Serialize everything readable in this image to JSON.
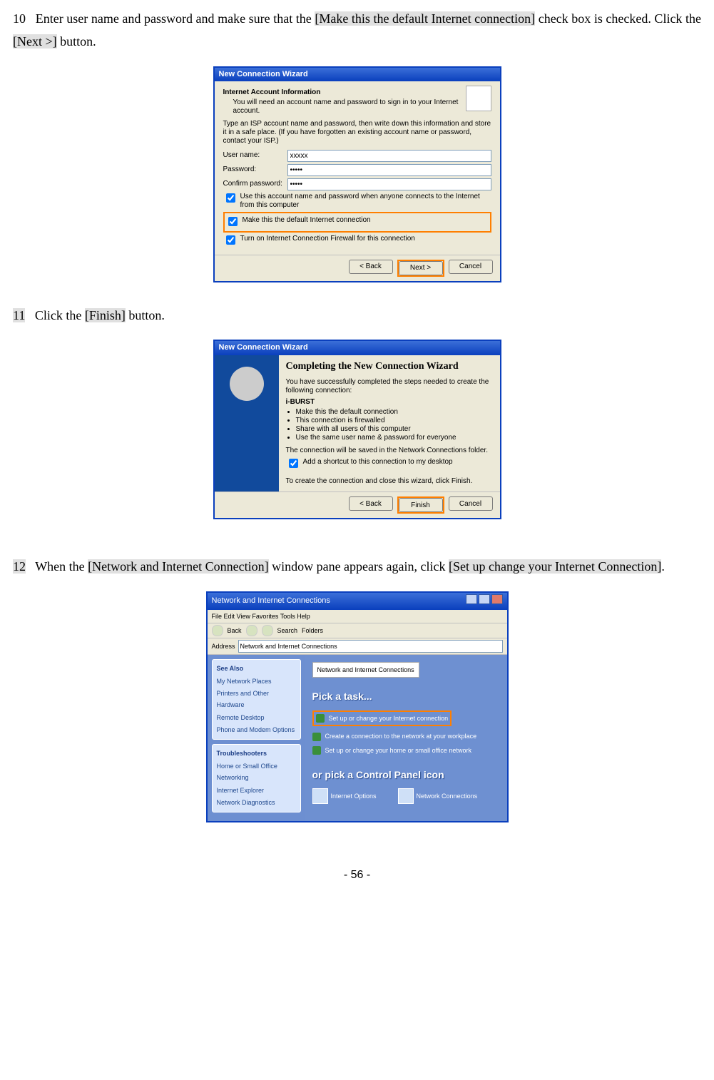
{
  "step10": {
    "num": "10",
    "t1": "Enter user name and password and make sure that the ",
    "h1": "[Make this the default Internet connection]",
    "t2": " check box is checked. Click the ",
    "h2": "[Next >]",
    "t3": " button."
  },
  "win1": {
    "title": "New Connection Wizard",
    "header": "Internet Account Information",
    "sub": "You will need an account name and password to sign in to your Internet account.",
    "note": "Type an ISP account name and password, then write down this information and store it in a safe place. (If you have forgotten an existing account name or password, contact your ISP.)",
    "l_user": "User name:",
    "v_user": "xxxxx",
    "l_pass": "Password:",
    "v_pass": "•••••",
    "l_cpass": "Confirm password:",
    "v_cpass": "•••••",
    "cb1": "Use this account name and password when anyone connects to the Internet from this computer",
    "cb2": "Make this the default Internet connection",
    "cb3": "Turn on Internet Connection Firewall for this connection",
    "back": "< Back",
    "next": "Next >",
    "cancel": "Cancel"
  },
  "step11": {
    "num": "11",
    "t1": "Click the ",
    "h1": "[Finish]",
    "t2": " button."
  },
  "win2": {
    "title": "New Connection Wizard",
    "h": "Completing the New Connection Wizard",
    "p1": "You have successfully completed the steps needed to create the following connection:",
    "name": "i-BURST",
    "b1": "Make this the default connection",
    "b2": "This connection is firewalled",
    "b3": "Share with all users of this computer",
    "b4": "Use the same user name & password for everyone",
    "p2": "The connection will be saved in the Network Connections folder.",
    "cb": "Add a shortcut to this connection to my desktop",
    "p3": "To create the connection and close this wizard, click Finish.",
    "back": "< Back",
    "finish": "Finish",
    "cancel": "Cancel"
  },
  "step12": {
    "num": "12",
    "t1": "When the ",
    "h1": "[Network and Internet Connection]",
    "t2": " window pane appears again, click ",
    "h2": "[Set up change your Internet Connection]",
    "t3": "."
  },
  "cp": {
    "title": "Network and Internet Connections",
    "menu": "File   Edit   View   Favorites   Tools   Help",
    "tool_back": "Back",
    "tool_search": "Search",
    "tool_folders": "Folders",
    "addr_label": "Address",
    "addr_value": "Network and Internet Connections",
    "sa_title": "See Also",
    "sa1": "My Network Places",
    "sa2": "Printers and Other Hardware",
    "sa3": "Remote Desktop",
    "sa4": "Phone and Modem Options",
    "tr_title": "Troubleshooters",
    "tr1": "Home or Small Office Networking",
    "tr2": "Internet Explorer",
    "tr3": "Network Diagnostics",
    "crumb": "Network and Internet Connections",
    "pick": "Pick a task...",
    "task1": "Set up or change your Internet connection",
    "task2": "Create a connection to the network at your workplace",
    "task3": "Set up or change your home or small office network",
    "or": "or pick a Control Panel icon",
    "ic1": "Internet Options",
    "ic2": "Network Connections"
  },
  "page_number": "- 56 -"
}
